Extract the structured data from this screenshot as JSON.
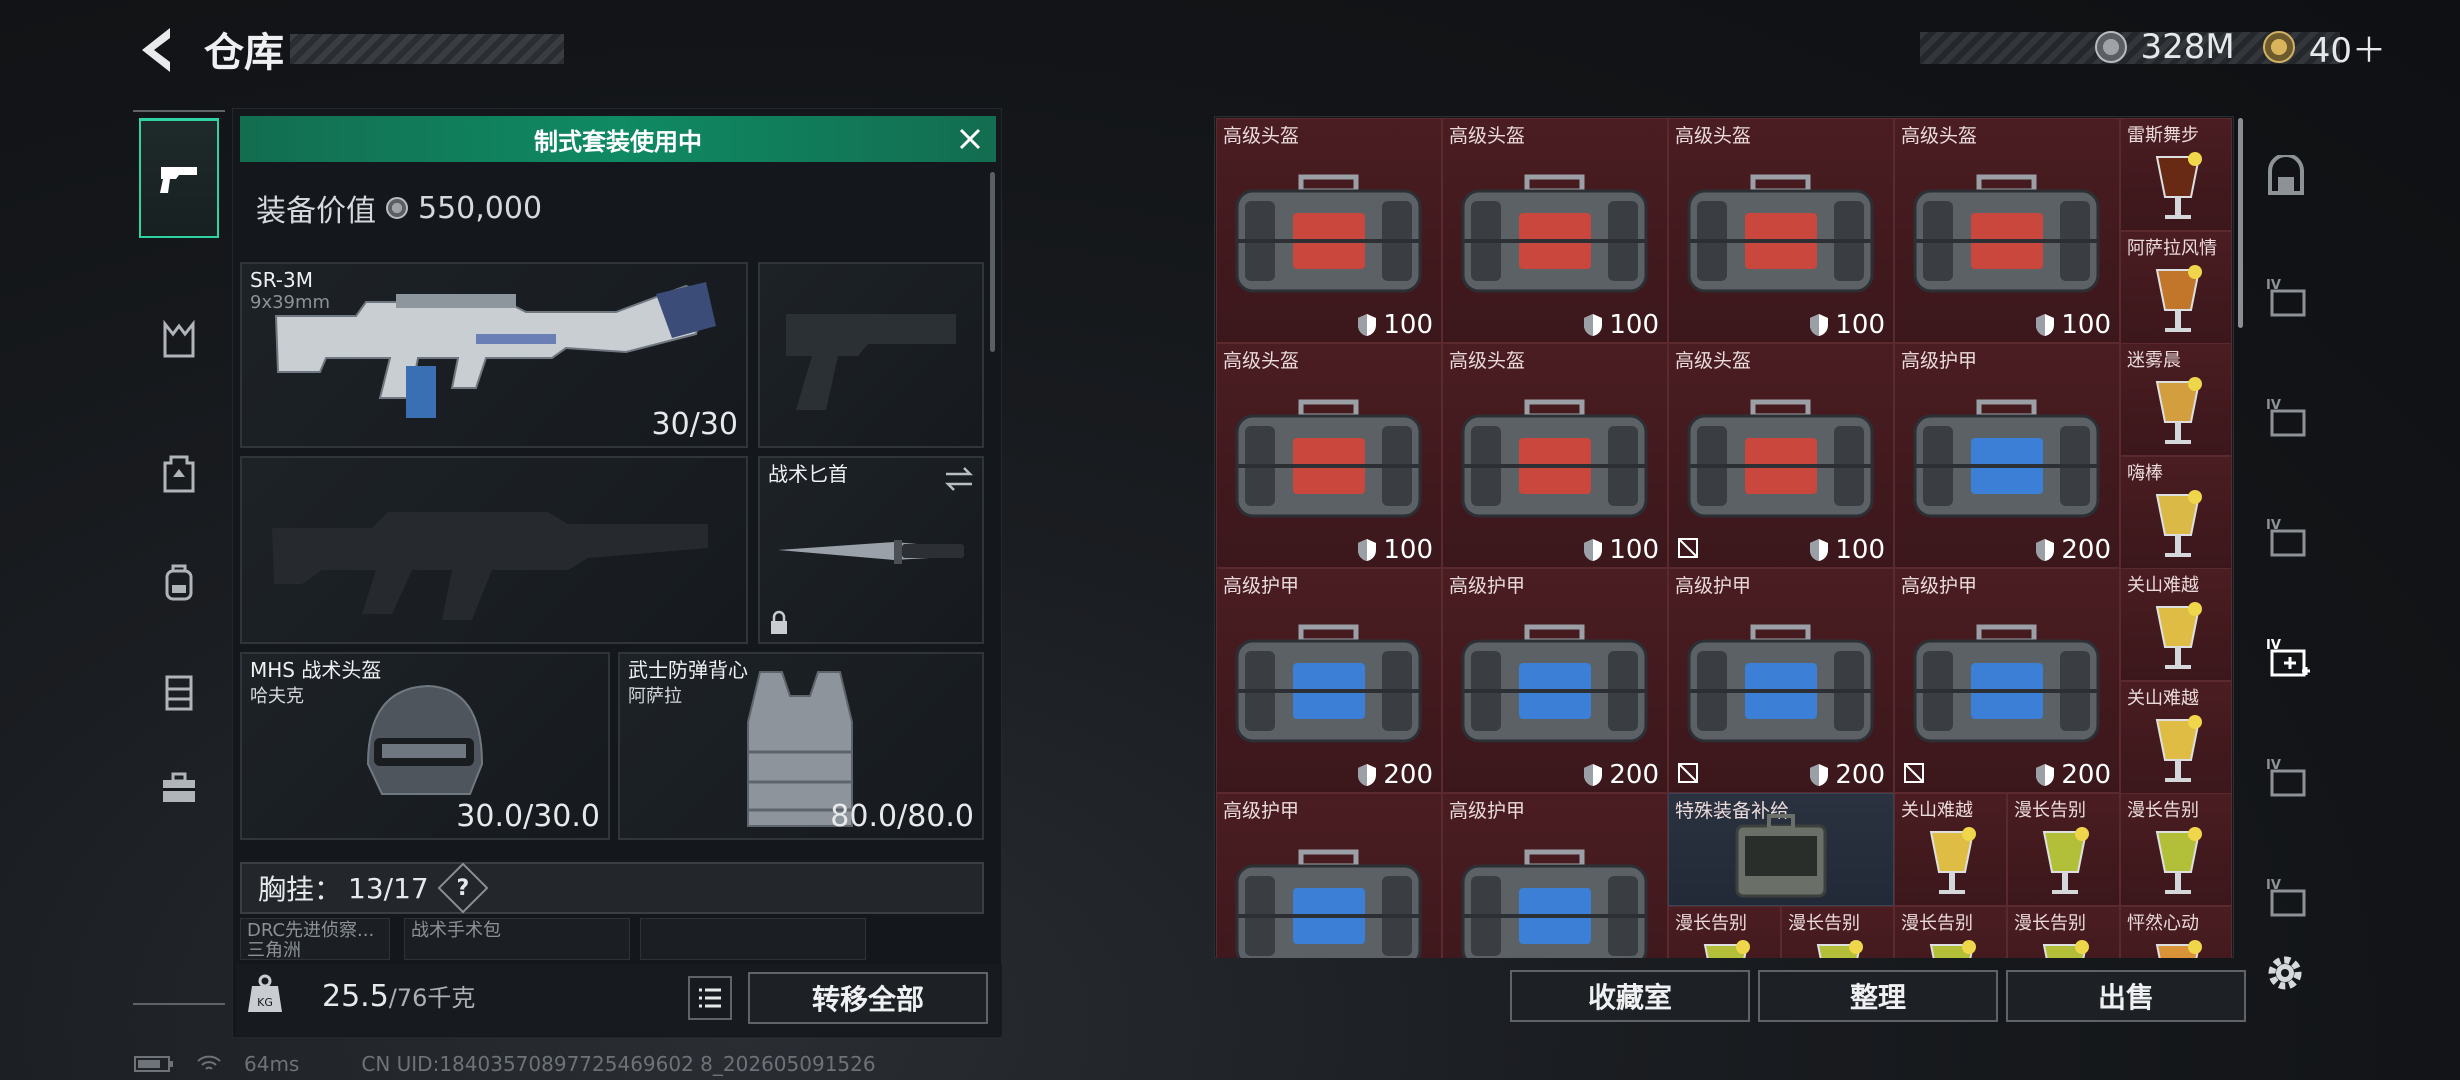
{
  "header": {
    "title": "仓库",
    "currency_silver": "328M",
    "currency_gold": "40＋"
  },
  "rail": {
    "items": [
      "pistol-icon",
      "armor-rig-icon",
      "chest-rig-icon",
      "backpack-icon",
      "container-icon",
      "case-icon"
    ]
  },
  "equipment": {
    "banner": "制式套装使用中",
    "value_label": "装备价值",
    "value": "550,000",
    "primary": {
      "name": "SR-3M",
      "caliber": "9x39mm",
      "count": "30/30"
    },
    "knife": {
      "name": "战术匕首"
    },
    "helmet": {
      "name": "MHS 战术头盔",
      "sub": "哈夫克",
      "durability": "30.0/30.0"
    },
    "vest": {
      "name": "武士防弹背心",
      "sub": "阿萨拉",
      "durability": "80.0/80.0"
    },
    "chest_rig": {
      "label": "胸挂：",
      "count": "13/17",
      "help": "?"
    },
    "mini_slots": [
      {
        "name": "DRC先进侦察...",
        "sub": "三角洲"
      },
      {
        "name": "战术手术包",
        "sub": ""
      },
      {
        "name": "",
        "sub": ""
      }
    ],
    "weight": "25.5",
    "weight_max": "/76千克",
    "transfer_all": "转移全部"
  },
  "inventory": {
    "cells": [
      {
        "label": "高级头盔",
        "value": "100",
        "kind": "helmet",
        "locked": false
      },
      {
        "label": "高级头盔",
        "value": "100",
        "kind": "helmet",
        "locked": false
      },
      {
        "label": "高级头盔",
        "value": "100",
        "kind": "helmet",
        "locked": false
      },
      {
        "label": "高级头盔",
        "value": "100",
        "kind": "helmet",
        "locked": false
      },
      {
        "label": "高级头盔",
        "value": "100",
        "kind": "helmet",
        "locked": false
      },
      {
        "label": "高级头盔",
        "value": "100",
        "kind": "helmet",
        "locked": false
      },
      {
        "label": "高级头盔",
        "value": "100",
        "kind": "helmet",
        "locked": true
      },
      {
        "label": "高级护甲",
        "value": "200",
        "kind": "armor",
        "locked": false
      },
      {
        "label": "高级护甲",
        "value": "200",
        "kind": "armor",
        "locked": false
      },
      {
        "label": "高级护甲",
        "value": "200",
        "kind": "armor",
        "locked": false
      },
      {
        "label": "高级护甲",
        "value": "200",
        "kind": "armor",
        "locked": true
      },
      {
        "label": "高级护甲",
        "value": "200",
        "kind": "armor",
        "locked": true
      },
      {
        "label": "高级护甲",
        "value": "",
        "kind": "armor",
        "locked": false
      },
      {
        "label": "高级护甲",
        "value": "",
        "kind": "armor",
        "locked": false
      }
    ],
    "special": {
      "label": "特殊装备补给"
    },
    "drinks": [
      {
        "label": "雷斯舞步"
      },
      {
        "label": "阿萨拉风情"
      },
      {
        "label": "迷雾晨"
      },
      {
        "label": "嗨棒"
      },
      {
        "label": "关山难越"
      },
      {
        "label": "关山难越"
      },
      {
        "label": "关山难越"
      },
      {
        "label": "漫长告别"
      },
      {
        "label": "漫长告别"
      },
      {
        "label": "漫长告别"
      },
      {
        "label": "漫长告别"
      },
      {
        "label": "漫长告别"
      },
      {
        "label": "漫长告别"
      },
      {
        "label": "漫长告别"
      },
      {
        "label": "怦然心动"
      }
    ],
    "buttons": {
      "collection": "收藏室",
      "sort": "整理",
      "sell": "出售"
    }
  },
  "category_rail": {
    "items": [
      "safe-icon",
      "iv-folder-icon",
      "iv-radio-icon",
      "iv-lock-icon",
      "iv-medkit-icon",
      "iv-gun-icon",
      "iv-box-icon"
    ]
  },
  "status": {
    "ping": "64ms",
    "uid": "CN UID:18403570897725469602 8_202605091526"
  },
  "colors": {
    "accent": "#0f8a63",
    "cell_bg": "#4a1d22",
    "special_bg": "#2a3240"
  }
}
